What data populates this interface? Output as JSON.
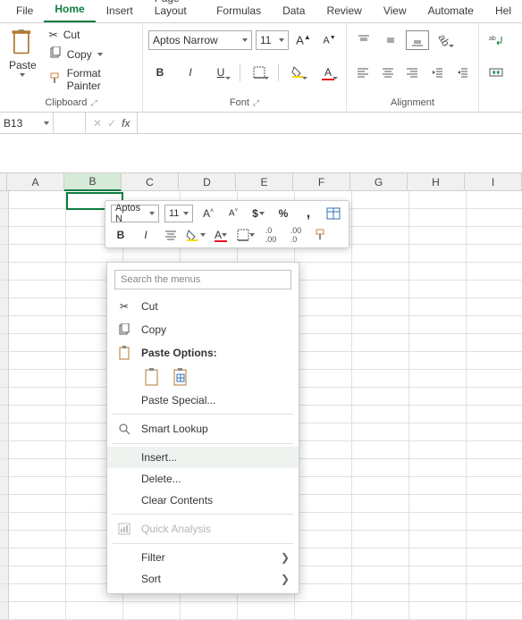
{
  "tabs": [
    "File",
    "Home",
    "Insert",
    "Page Layout",
    "Formulas",
    "Data",
    "Review",
    "View",
    "Automate",
    "Hel"
  ],
  "active_tab": 1,
  "clipboard": {
    "paste": "Paste",
    "cut": "Cut",
    "copy": "Copy",
    "format_painter": "Format Painter",
    "label": "Clipboard"
  },
  "font": {
    "name": "Aptos Narrow",
    "size": "11",
    "label": "Font"
  },
  "alignment": {
    "label": "Alignment"
  },
  "namebox": "B13",
  "fx": "fx",
  "columns": [
    "A",
    "B",
    "C",
    "D",
    "E",
    "F",
    "G",
    "H",
    "I"
  ],
  "mini": {
    "font": "Aptos N",
    "size": "11"
  },
  "ctx": {
    "search_ph": "Search the menus",
    "cut": "Cut",
    "copy": "Copy",
    "paste_options": "Paste Options:",
    "paste_special": "Paste Special...",
    "smart_lookup": "Smart Lookup",
    "insert": "Insert...",
    "delete": "Delete...",
    "clear": "Clear Contents",
    "quick": "Quick Analysis",
    "filter": "Filter",
    "sort": "Sort"
  }
}
